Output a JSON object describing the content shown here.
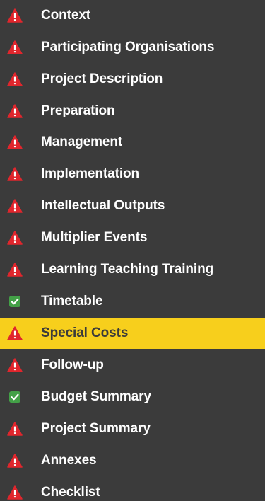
{
  "menu": {
    "items": [
      {
        "label": "Context",
        "status": "warning"
      },
      {
        "label": "Participating Organisations",
        "status": "warning"
      },
      {
        "label": "Project Description",
        "status": "warning"
      },
      {
        "label": "Preparation",
        "status": "warning"
      },
      {
        "label": "Management",
        "status": "warning"
      },
      {
        "label": "Implementation",
        "status": "warning"
      },
      {
        "label": "Intellectual Outputs",
        "status": "warning"
      },
      {
        "label": "Multiplier Events",
        "status": "warning"
      },
      {
        "label": "Learning Teaching Training",
        "status": "warning"
      },
      {
        "label": "Timetable",
        "status": "complete"
      },
      {
        "label": "Special Costs",
        "status": "warning",
        "active": true
      },
      {
        "label": "Follow-up",
        "status": "warning"
      },
      {
        "label": "Budget Summary",
        "status": "complete"
      },
      {
        "label": "Project Summary",
        "status": "warning"
      },
      {
        "label": "Annexes",
        "status": "warning"
      },
      {
        "label": "Checklist",
        "status": "warning"
      }
    ]
  },
  "colors": {
    "background": "#3b3b3b",
    "active_background": "#f7cf1c",
    "warning_icon": "#e0262d",
    "complete_icon": "#43a047",
    "label_text": "#ffffff"
  },
  "icons": {
    "warning": "warning-triangle-icon",
    "complete": "checkbox-checked-icon"
  }
}
